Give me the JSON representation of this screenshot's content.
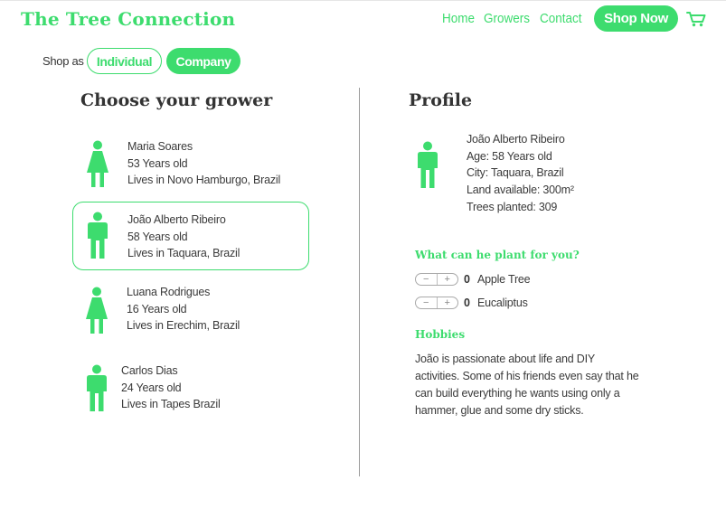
{
  "brand": "The Tree Connection",
  "nav": {
    "home": "Home",
    "growers": "Growers",
    "contact": "Contact",
    "shop_now": "Shop Now"
  },
  "shop_as": {
    "label": "Shop as",
    "individual": "Individual",
    "company": "Company",
    "active": "Company"
  },
  "left_title": "Choose your grower",
  "growers": [
    {
      "name": "Maria Soares",
      "age": "53 Years old",
      "location": "Lives in Novo Hamburgo, Brazil",
      "figure": "female-person-icon"
    },
    {
      "name": "João Alberto Ribeiro",
      "age": "58 Years old",
      "location": "Lives in Taquara, Brazil",
      "figure": "male-person-icon",
      "selected": true
    },
    {
      "name": "Luana Rodrigues",
      "age": "16 Years old",
      "location": "Lives in Erechim, Brazil",
      "figure": "female-person-icon"
    },
    {
      "name": "Carlos Dias",
      "age": "24 Years old",
      "location": "Lives in Tapes Brazil",
      "figure": "male-person-icon"
    }
  ],
  "profile": {
    "title": "Profile",
    "name": "João Alberto Ribeiro",
    "age": "Age: 58 Years old",
    "city": "City: Taquara, Brazil",
    "land": "Land available: 300m²",
    "trees": "Trees planted: 309",
    "plant_heading": "What can he plant for you?",
    "plants": [
      {
        "count": "0",
        "name": "Apple Tree"
      },
      {
        "count": "0",
        "name": "Eucaliptus"
      }
    ],
    "stepper_minus": "−",
    "stepper_plus": "+",
    "hobbies_heading": "Hobbies",
    "hobbies_text": "João is passionate about life and DIY activities. Some of his friends even say that he can build everything he wants using only a hammer, glue and some dry sticks."
  },
  "colors": {
    "accent": "#3ddc6e",
    "text": "#3a3a3a",
    "divider": "#9a9a9a"
  }
}
